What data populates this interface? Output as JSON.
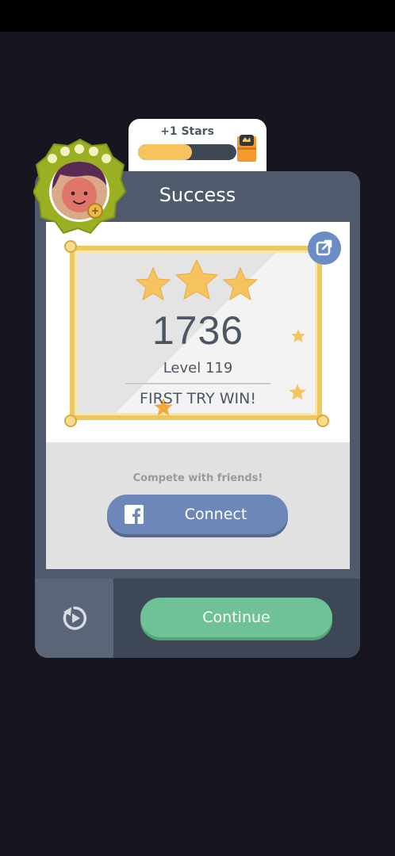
{
  "stars_tab": {
    "label": "+1 Stars",
    "progress": 0.55
  },
  "card": {
    "title": "Success"
  },
  "result": {
    "score": "1736",
    "level": "Level 119",
    "message": "FIRST TRY WIN!"
  },
  "social": {
    "prompt": "Compete with friends!",
    "connect_label": "Connect"
  },
  "actions": {
    "continue_label": "Continue"
  },
  "icons": {
    "share": "share-icon",
    "facebook": "facebook-icon",
    "replay": "replay-icon",
    "chest": "treasure-chest-icon",
    "avatar": "avatar-icon"
  },
  "colors": {
    "background": "#171520",
    "card": "#4f5b6c",
    "gold": "#efc760",
    "facebook": "#6e87b9",
    "continue": "#6fc295"
  }
}
